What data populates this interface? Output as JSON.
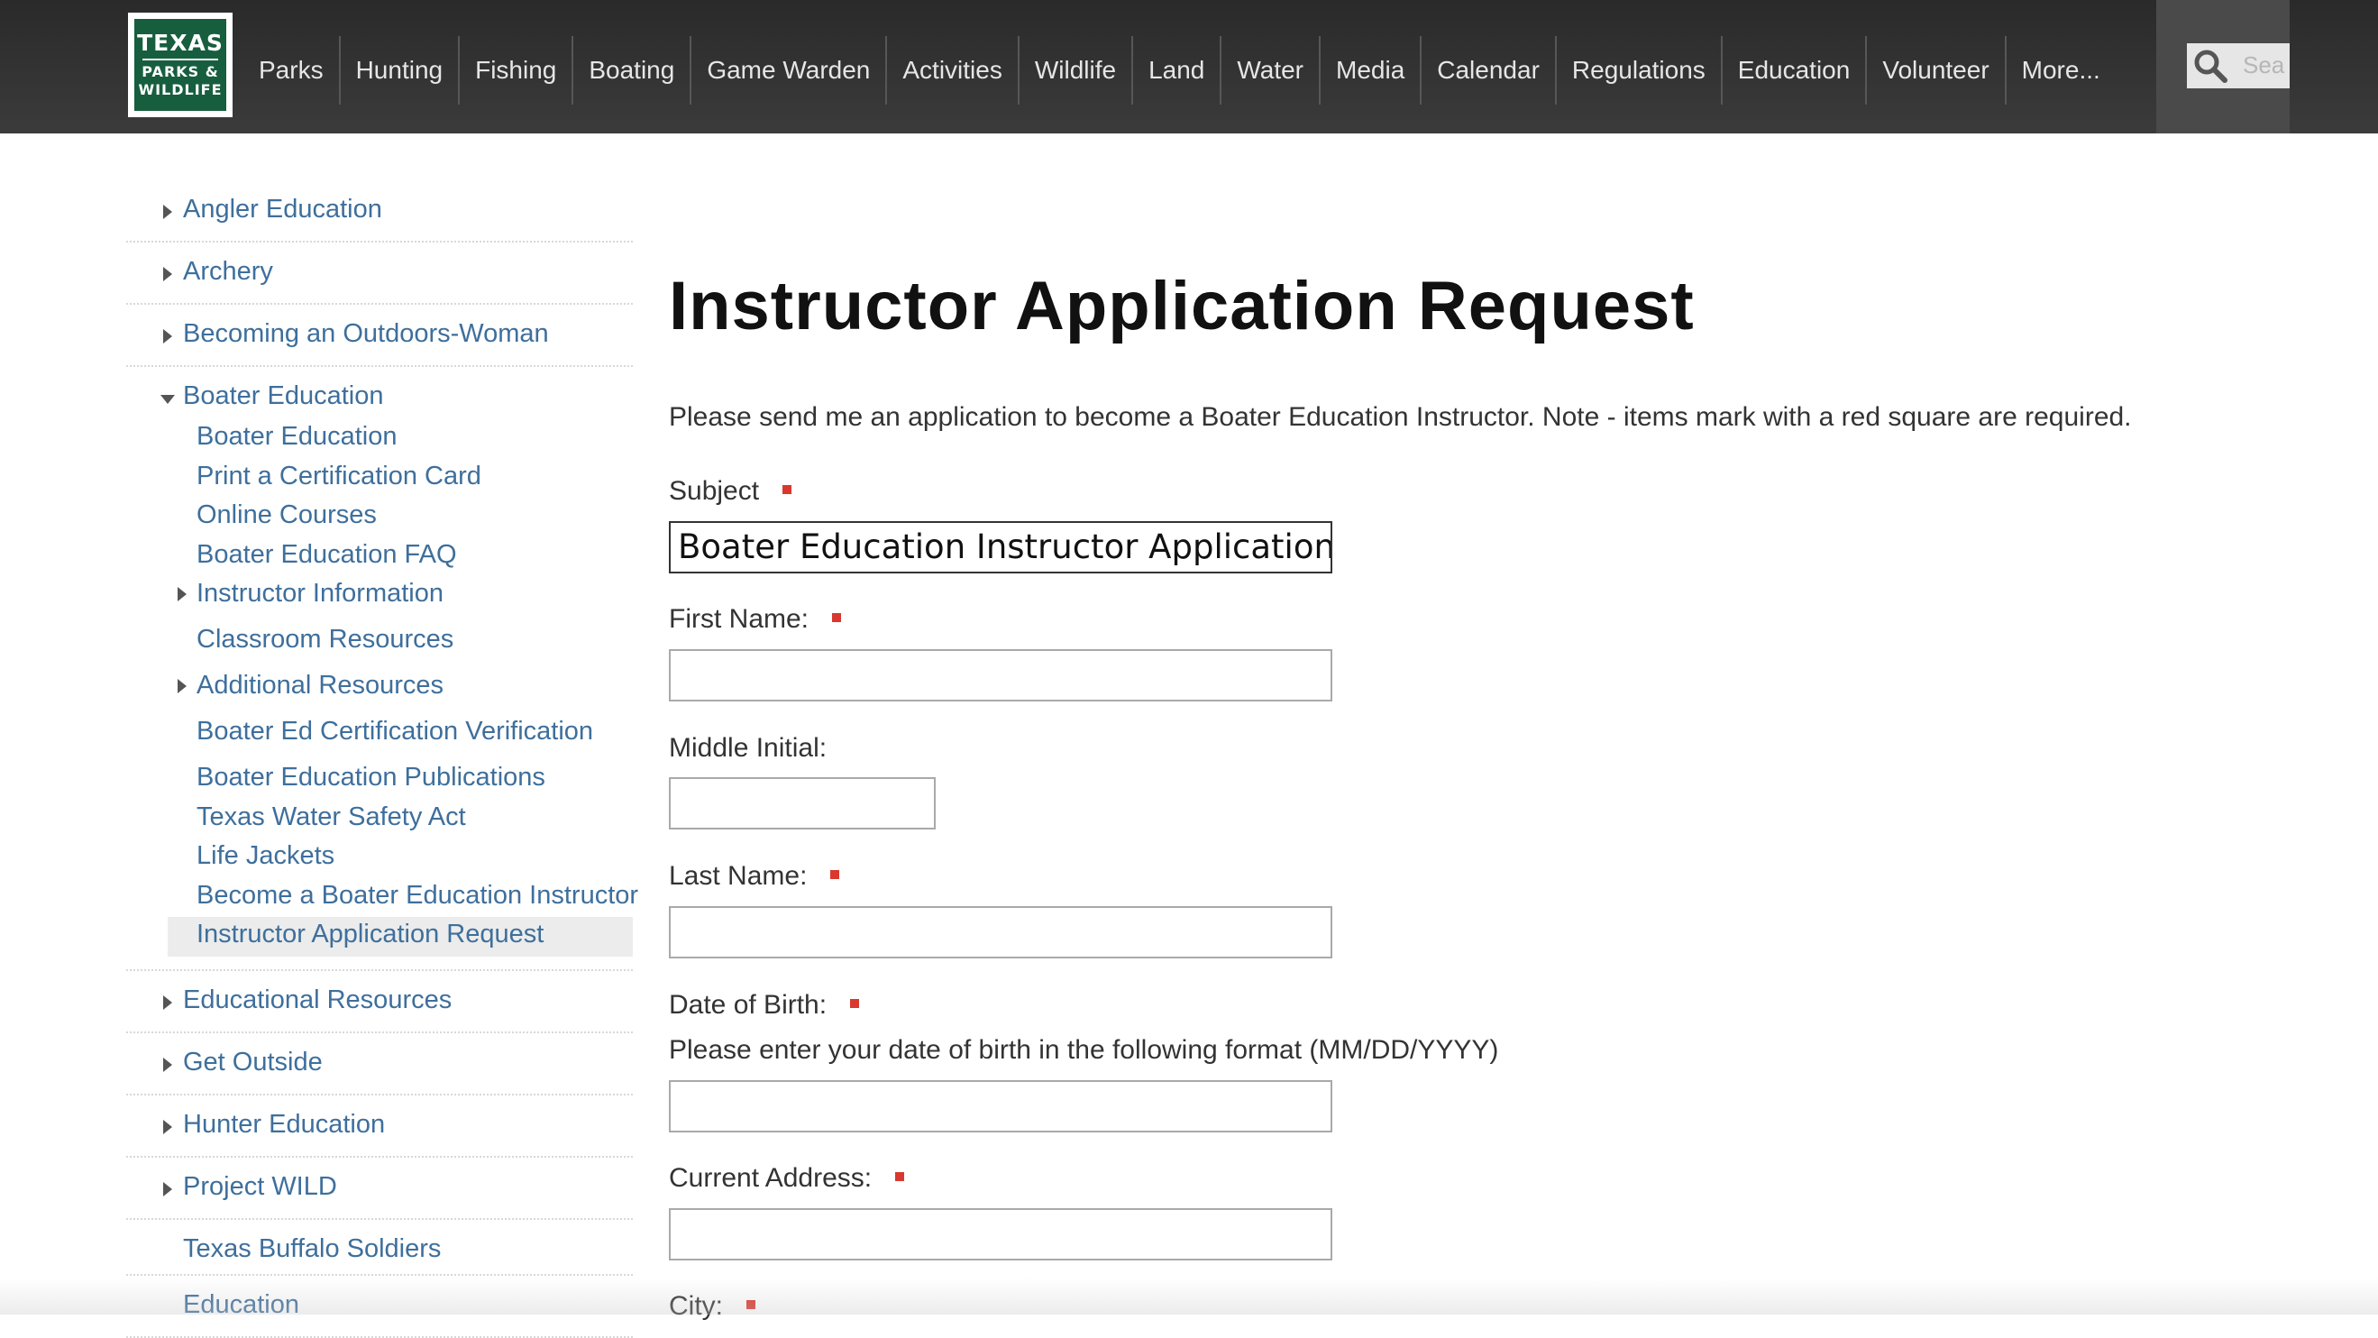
{
  "logo": {
    "line1": "TEXAS",
    "line2": "PARKS &",
    "line3": "WILDLIFE"
  },
  "nav": {
    "items": [
      "Parks",
      "Hunting",
      "Fishing",
      "Boating",
      "Game Warden",
      "Activities",
      "Wildlife",
      "Land",
      "Water",
      "Media",
      "Calendar",
      "Regulations",
      "Education",
      "Volunteer",
      "More..."
    ],
    "search_placeholder": "Sea"
  },
  "sidebar": {
    "top_items_before": [
      "Angler Education",
      "Archery",
      "Becoming an Outdoors-Woman"
    ],
    "expanded": {
      "label": "Boater Education",
      "children": [
        {
          "label": "Boater Education",
          "has_children": false
        },
        {
          "label": "Print a Certification Card",
          "has_children": false
        },
        {
          "label": "Online Courses",
          "has_children": false
        },
        {
          "label": "Boater Education FAQ",
          "has_children": false
        },
        {
          "label": "Instructor Information",
          "has_children": true
        },
        {
          "label": "Classroom Resources",
          "has_children": false
        },
        {
          "label": "Additional Resources",
          "has_children": true
        },
        {
          "label": "Boater Ed Certification Verification",
          "has_children": false
        },
        {
          "label": "Boater Education Publications",
          "has_children": false
        },
        {
          "label": "Texas Water Safety Act",
          "has_children": false
        },
        {
          "label": "Life Jackets",
          "has_children": false
        },
        {
          "label": "Become a Boater Education Instructor",
          "has_children": false
        },
        {
          "label": "Instructor Application Request",
          "has_children": false,
          "selected": true
        }
      ]
    },
    "top_items_after": [
      {
        "label": "Educational Resources",
        "has_children": true
      },
      {
        "label": "Get Outside",
        "has_children": true
      },
      {
        "label": "Hunter Education",
        "has_children": true
      },
      {
        "label": "Project WILD",
        "has_children": true
      },
      {
        "label": "Texas Buffalo Soldiers",
        "has_children": false
      },
      {
        "label": "Education",
        "has_children": false
      }
    ]
  },
  "main": {
    "title": "Instructor Application Request",
    "intro": "Please send me an application to become a Boater Education Instructor. Note - items mark with a red square are required.",
    "fields": {
      "subject": {
        "label": "Subject",
        "value": "Boater Education Instructor Application Request",
        "required": true
      },
      "first_name": {
        "label": "First Name:",
        "value": "",
        "required": true
      },
      "middle_initial": {
        "label": "Middle Initial:",
        "value": "",
        "required": false
      },
      "last_name": {
        "label": "Last Name:",
        "value": "",
        "required": true
      },
      "dob": {
        "label": "Date of Birth:",
        "hint": "Please enter your date of birth in the following format (MM/DD/YYYY)",
        "value": "",
        "required": true
      },
      "address": {
        "label": "Current Address:",
        "value": "",
        "required": true
      },
      "city": {
        "label": "City:",
        "required": true
      }
    }
  },
  "colors": {
    "nav_bg": "#333333",
    "link": "#3e6f9c",
    "required_marker": "#d9382e",
    "logo_green": "#175e3f"
  }
}
